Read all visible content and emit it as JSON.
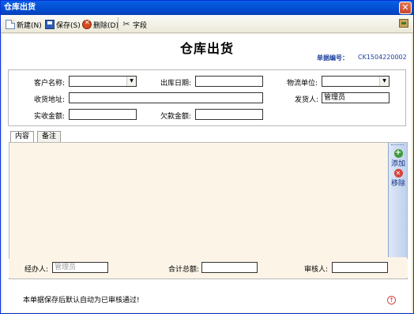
{
  "window": {
    "title": "仓库出货",
    "close_label": "✕"
  },
  "toolbar": {
    "new_label": "新建(N)",
    "save_label": "保存(S)",
    "delete_label": "删除(D)",
    "field_label": "字段"
  },
  "document": {
    "title": "仓库出货",
    "number_label": "单据编号：",
    "number_value": "CK1504220002"
  },
  "form": {
    "customer_label": "客户名称:",
    "customer_value": "",
    "date_label": "出库日期:",
    "date_value": "",
    "logistics_label": "物流单位:",
    "logistics_value": "",
    "address_label": "收货地址:",
    "address_value": "",
    "shipper_label": "发货人:",
    "shipper_value": "管理员",
    "received_label": "实收金额:",
    "received_value": "",
    "owed_label": "欠款金额:",
    "owed_value": ""
  },
  "tabs": [
    {
      "label": "内容",
      "active": true
    },
    {
      "label": "备注",
      "active": false
    }
  ],
  "side_actions": {
    "add_label": "添加",
    "remove_label": "移除"
  },
  "footer": {
    "handler_label": "经办人:",
    "handler_placeholder": "管理员",
    "total_label": "合计总额:",
    "total_value": "",
    "auditor_label": "审核人:",
    "auditor_value": ""
  },
  "status": {
    "message": "本单据保存后默认自动为已审核通过!"
  },
  "colors": {
    "titlebar": "#0553d6",
    "panel_bg": "#fcf5e7",
    "doc_number": "#1d3fa0"
  }
}
